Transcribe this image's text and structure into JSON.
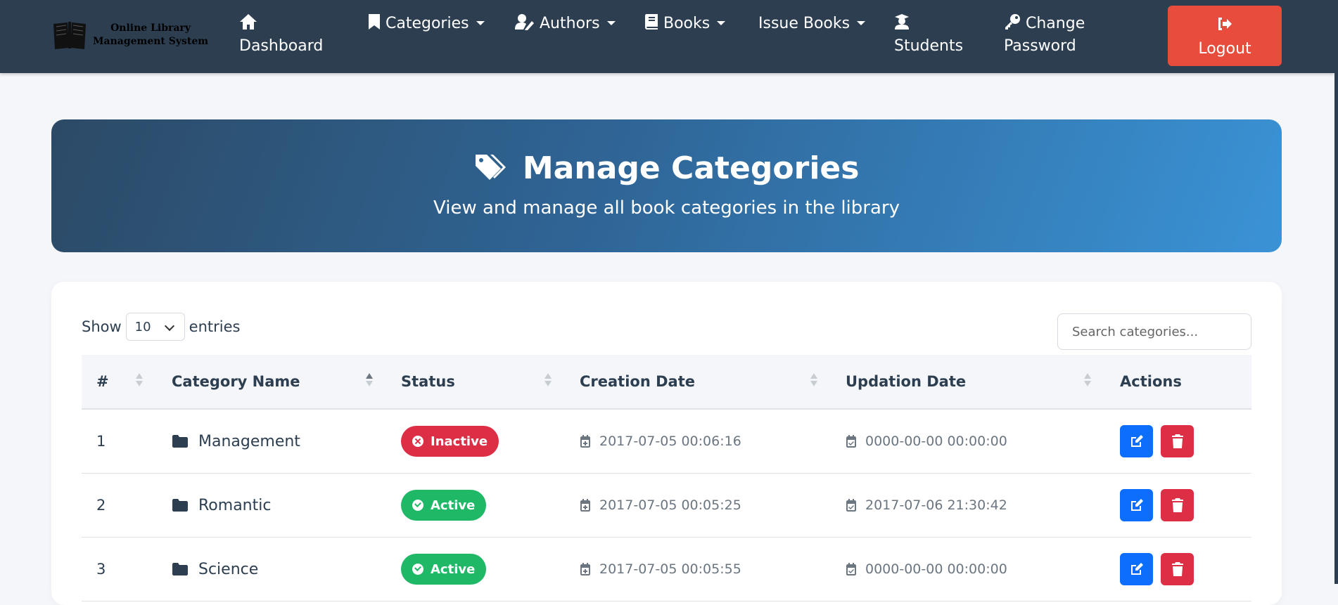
{
  "brand": {
    "line1": "Online Library",
    "line2": "Management System",
    "logo_icon": "open-book-icon"
  },
  "nav": {
    "dashboard": "Dashboard",
    "categories": "Categories",
    "authors": "Authors",
    "books": "Books",
    "issue_books": "Issue Books",
    "students": "Students",
    "change_password_line1": "Change",
    "change_password_line2": "Password",
    "logout": "Logout"
  },
  "hero": {
    "title": "Manage Categories",
    "subtitle": "View and manage all book categories in the library"
  },
  "table_controls": {
    "show_label": "Show",
    "entries_value": "10",
    "entries_label": "entries",
    "search_placeholder": "Search categories..."
  },
  "table": {
    "columns": [
      "#",
      "Category Name",
      "Status",
      "Creation Date",
      "Updation Date",
      "Actions"
    ],
    "rows": [
      {
        "num": "1",
        "name": "Management",
        "status": "Inactive",
        "created": "2017-07-05 00:06:16",
        "updated": "0000-00-00 00:00:00"
      },
      {
        "num": "2",
        "name": "Romantic",
        "status": "Active",
        "created": "2017-07-05 00:05:25",
        "updated": "2017-07-06 21:30:42"
      },
      {
        "num": "3",
        "name": "Science",
        "status": "Active",
        "created": "2017-07-05 00:05:55",
        "updated": "0000-00-00 00:00:00"
      }
    ]
  },
  "colors": {
    "navbar": "#2c3e50",
    "logout": "#e74c3c",
    "active": "#1fb866",
    "inactive": "#dc2f45",
    "edit": "#0d6efd"
  }
}
